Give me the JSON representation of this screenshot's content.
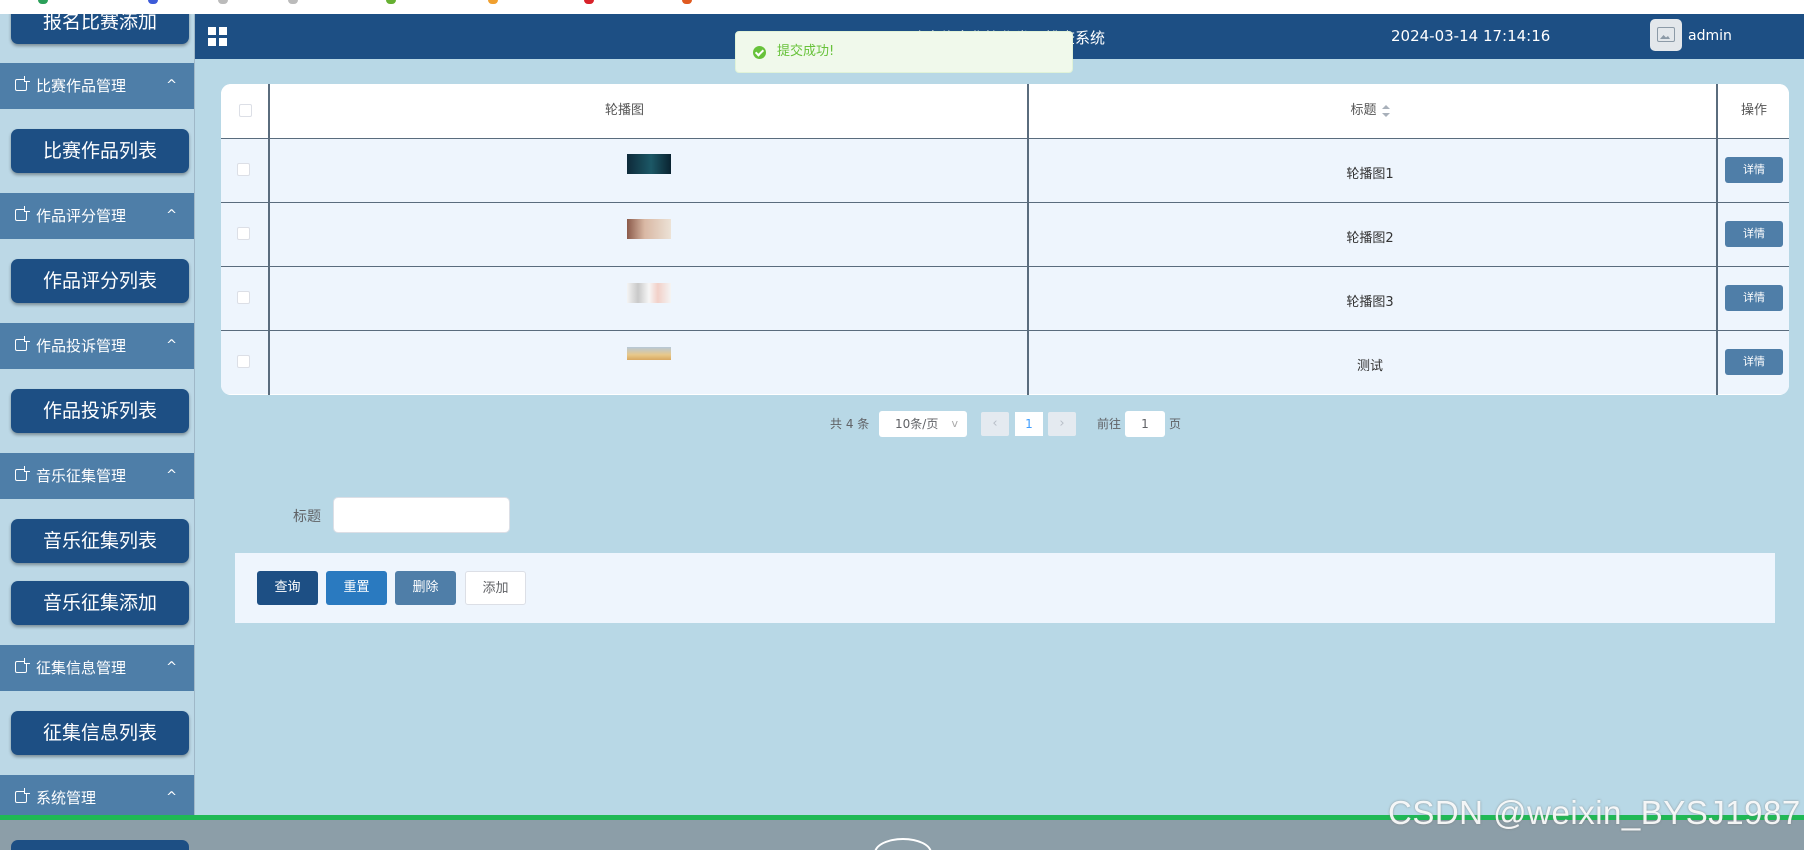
{
  "app": {
    "title": "政府信息化协作发展排查系统",
    "datetime": "2024-03-14 17:14:16",
    "username": "admin"
  },
  "toast": {
    "message": "提交成功!",
    "icon": "success-check-icon",
    "color": "#67c23a"
  },
  "sidebar": {
    "items": [
      {
        "type": "button",
        "label": "报名比赛添加"
      },
      {
        "type": "group",
        "label": "比赛作品管理"
      },
      {
        "type": "button",
        "label": "比赛作品列表"
      },
      {
        "type": "group",
        "label": "作品评分管理"
      },
      {
        "type": "button",
        "label": "作品评分列表"
      },
      {
        "type": "group",
        "label": "作品投诉管理"
      },
      {
        "type": "button",
        "label": "作品投诉列表"
      },
      {
        "type": "group",
        "label": "音乐征集管理"
      },
      {
        "type": "button",
        "label": "音乐征集列表"
      },
      {
        "type": "button",
        "label": "音乐征集添加"
      },
      {
        "type": "group",
        "label": "征集信息管理"
      },
      {
        "type": "button",
        "label": "征集信息列表"
      },
      {
        "type": "group",
        "label": "系统管理"
      }
    ]
  },
  "table": {
    "headers": {
      "image": "轮播图",
      "title": "标题",
      "action": "操作"
    },
    "rows": [
      {
        "title": "轮播图1",
        "action": "详情"
      },
      {
        "title": "轮播图2",
        "action": "详情"
      },
      {
        "title": "轮播图3",
        "action": "详情"
      },
      {
        "title": "测试",
        "action": "详情"
      }
    ]
  },
  "pagination": {
    "total": "共 4 条",
    "page_size": "10条/页",
    "current_page": "1",
    "goto_label": "前往",
    "goto_value": "1",
    "page_suffix": "页"
  },
  "search": {
    "label": "标题",
    "value": ""
  },
  "actions": {
    "query": "查询",
    "reset": "重置",
    "delete": "删除",
    "add": "添加"
  },
  "colors": {
    "primary": "#1d4f84",
    "group": "#4e7ea8",
    "success": "#1fb955",
    "background": "#b8d8e6"
  },
  "watermark": "CSDN @weixin_BYSJ1987"
}
